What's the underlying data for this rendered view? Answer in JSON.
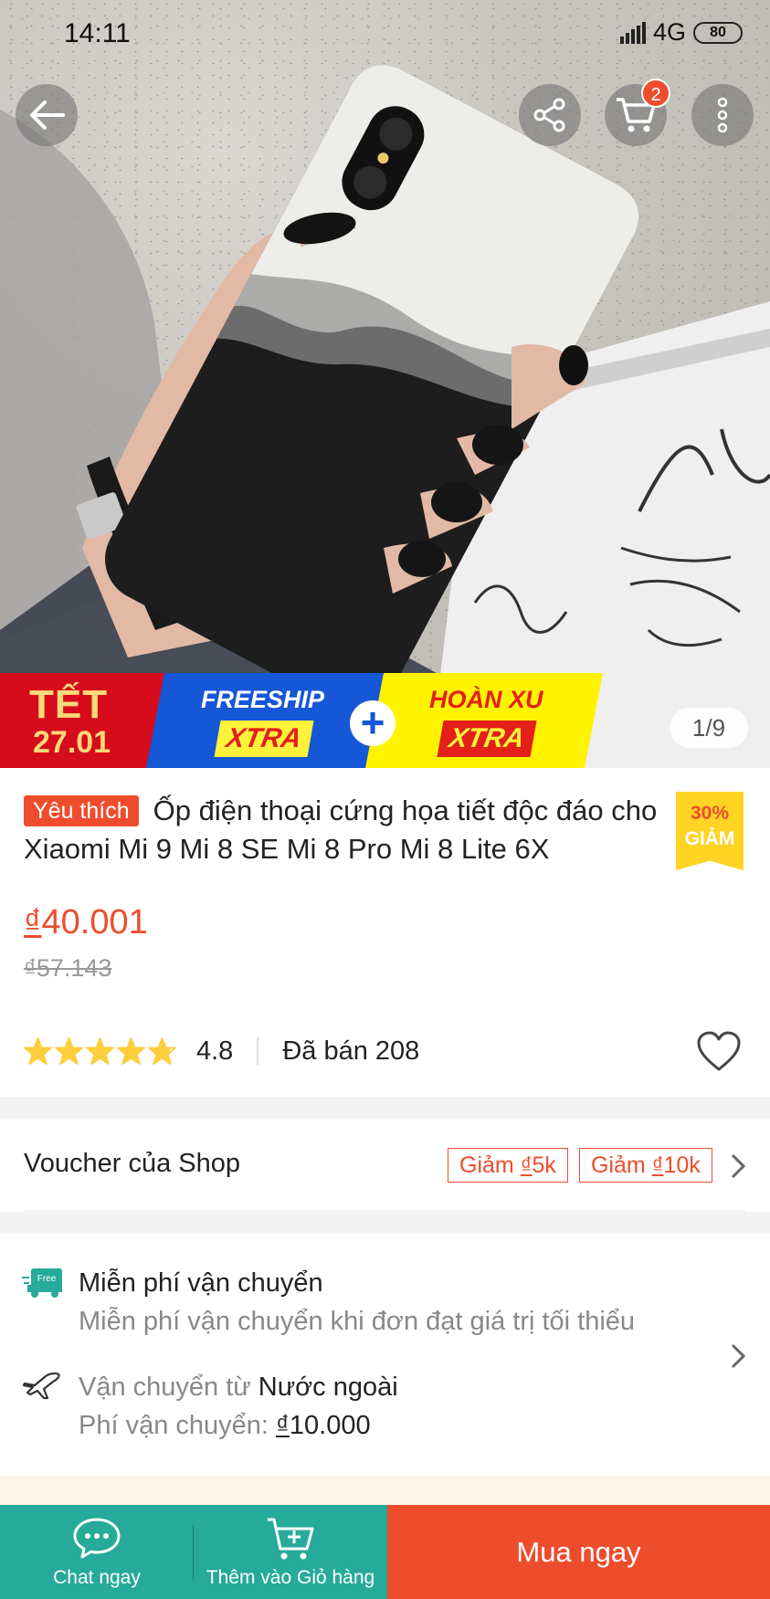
{
  "status_bar": {
    "time": "14:11",
    "network": "4G",
    "battery": "80"
  },
  "top_actions": {
    "cart_count": "2"
  },
  "image": {
    "counter": "1/9"
  },
  "promo_banner": {
    "tet_line1": "TẾT",
    "tet_line2": "27.01",
    "freeship": "FREESHIP",
    "freeship_xtra": "XTRA",
    "plus": "+",
    "hoanxu": "HOÀN XU",
    "hoanxu_xtra": "XTRA"
  },
  "product": {
    "tag": "Yêu thích",
    "title": "Ốp điện thoại cứng họa tiết độc đáo cho Xiaomi Mi 9 Mi 8 SE Mi 8 Pro Mi 8 Lite 6X",
    "discount_percent": "30%",
    "discount_label": "GIẢM",
    "price_currency": "₫",
    "price": "40.001",
    "old_price": "₫57.143",
    "rating": "4.8",
    "rating_value": 4.8,
    "sold": "Đã bán 208"
  },
  "voucher": {
    "label": "Voucher của Shop",
    "tags": [
      {
        "prefix": "Giảm ",
        "currency": "₫",
        "amount": "5k"
      },
      {
        "prefix": "Giảm ",
        "currency": "₫",
        "amount": "10k"
      }
    ]
  },
  "shipping": {
    "free_badge": "Free",
    "free_title": "Miễn phí vận chuyển",
    "free_desc": "Miễn phí vận chuyển khi đơn đạt giá trị tối thiểu",
    "from_label": "Vận chuyển từ ",
    "from_value": "Nước ngoài",
    "fee_label": "Phí vận chuyển: ",
    "fee_currency": "₫",
    "fee_value": "10.000"
  },
  "bottom_bar": {
    "chat_label": "Chat ngay",
    "add_cart_label": "Thêm vào Giỏ hàng",
    "buy_label": "Mua ngay"
  },
  "colors": {
    "accent": "#ee4d2d",
    "teal": "#26aa99",
    "star": "#ffce3d",
    "discount_badge": "#ffd424"
  }
}
